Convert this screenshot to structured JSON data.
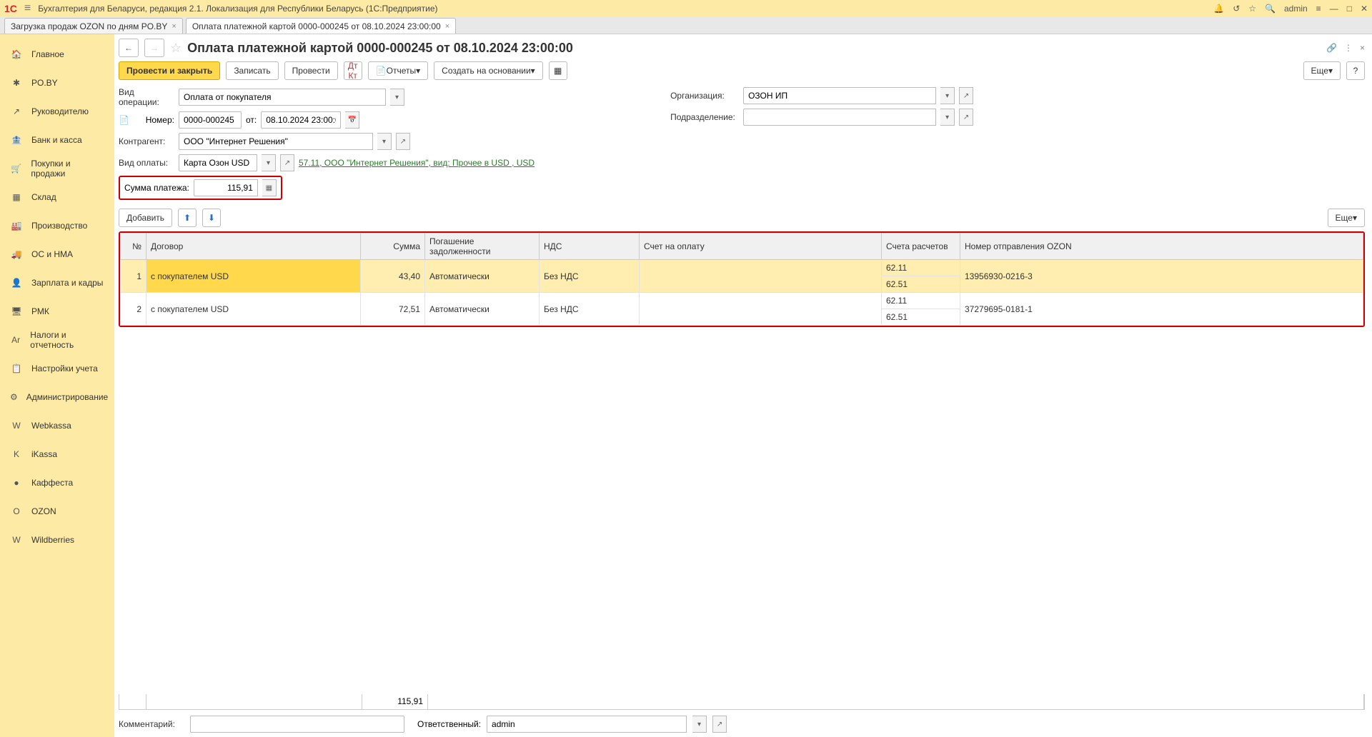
{
  "titlebar": {
    "app_title": "Бухгалтерия для Беларуси, редакция 2.1. Локализация для Республики Беларусь   (1С:Предприятие)",
    "user": "admin"
  },
  "tabs": [
    {
      "label": "Загрузка продаж OZON по дням PO.BY"
    },
    {
      "label": "Оплата платежной картой 0000-000245 от 08.10.2024 23:00:00"
    }
  ],
  "sidebar": [
    {
      "icon": "🏠",
      "label": "Главное"
    },
    {
      "icon": "✱",
      "label": "PO.BY"
    },
    {
      "icon": "↗",
      "label": "Руководителю"
    },
    {
      "icon": "🏦",
      "label": "Банк и касса"
    },
    {
      "icon": "🛒",
      "label": "Покупки и продажи"
    },
    {
      "icon": "▦",
      "label": "Склад"
    },
    {
      "icon": "🏭",
      "label": "Производство"
    },
    {
      "icon": "🚚",
      "label": "ОС и НМА"
    },
    {
      "icon": "👤",
      "label": "Зарплата и кадры"
    },
    {
      "icon": "🖥",
      "label": "РМК"
    },
    {
      "icon": "Ar",
      "label": "Налоги и отчетность"
    },
    {
      "icon": "📋",
      "label": "Настройки учета"
    },
    {
      "icon": "⚙",
      "label": "Администрирование"
    },
    {
      "icon": "W",
      "label": "Webkassa"
    },
    {
      "icon": "K",
      "label": "iKassa"
    },
    {
      "icon": "●",
      "label": "Каффеста"
    },
    {
      "icon": "O",
      "label": "OZON"
    },
    {
      "icon": "W",
      "label": "Wildberries"
    }
  ],
  "doc": {
    "title": "Оплата платежной картой 0000-000245 от 08.10.2024 23:00:00",
    "buttons": {
      "post_close": "Провести и закрыть",
      "write": "Записать",
      "post": "Провести",
      "reports": "Отчеты",
      "create_on": "Создать на основании",
      "more": "Еще"
    },
    "labels": {
      "operation": "Вид операции:",
      "number": "Номер:",
      "from": "от:",
      "contractor": "Контрагент:",
      "pay_type": "Вид оплаты:",
      "sum": "Сумма платежа:",
      "org": "Организация:",
      "dept": "Подразделение:",
      "add": "Добавить",
      "comment": "Комментарий:",
      "responsible": "Ответственный:"
    },
    "operation": "Оплата от покупателя",
    "number": "0000-000245",
    "date": "08.10.2024 23:00:00",
    "contractor": "ООО \"Интернет Решения\"",
    "pay_type": "Карта Озон USD",
    "pay_link": "57.11, ООО \"Интернет Решения\", вид: Прочее в USD , USD",
    "sum": "115,91",
    "org": "ОЗОН ИП",
    "dept": "",
    "responsible": "admin",
    "comment": ""
  },
  "table": {
    "headers": {
      "n": "№",
      "contract": "Договор",
      "sum": "Сумма",
      "repay": "Погашение задолженности",
      "nds": "НДС",
      "invoice": "Счет на оплату",
      "accounts": "Счета расчетов",
      "shipment": "Номер отправления OZON"
    },
    "rows": [
      {
        "n": "1",
        "contract": "с покупателем USD",
        "sum": "43,40",
        "repay": "Автоматически",
        "nds": "Без НДС",
        "invoice": "",
        "acc1": "62.11",
        "acc2": "62.51",
        "ship": "13956930-0216-3"
      },
      {
        "n": "2",
        "contract": "с покупателем USD",
        "sum": "72,51",
        "repay": "Автоматически",
        "nds": "Без НДС",
        "invoice": "",
        "acc1": "62.11",
        "acc2": "62.51",
        "ship": "37279695-0181-1"
      }
    ],
    "footer_sum": "115,91"
  }
}
